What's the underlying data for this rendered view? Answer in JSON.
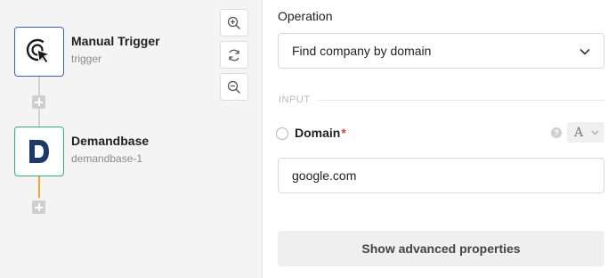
{
  "canvas": {
    "nodes": [
      {
        "title": "Manual Trigger",
        "subtitle": "trigger",
        "icon": "cursor-click-icon",
        "border_color": "#3f5bd0"
      },
      {
        "title": "Demandbase",
        "subtitle": "demandbase-1",
        "icon": "demandbase-logo",
        "border_color": "#2bb673"
      }
    ],
    "connector_color_active": "#f5a623",
    "zoom_controls": [
      "zoom-in-icon",
      "refresh-icon",
      "zoom-out-icon"
    ]
  },
  "panel": {
    "operation_label": "Operation",
    "operation_value": "Find company by domain",
    "section_label": "INPUT",
    "field": {
      "label": "Domain",
      "required_mark": "*",
      "help_symbol": "?",
      "type_symbol": "A",
      "value": "google.com"
    },
    "advanced_button": "Show advanced properties"
  }
}
